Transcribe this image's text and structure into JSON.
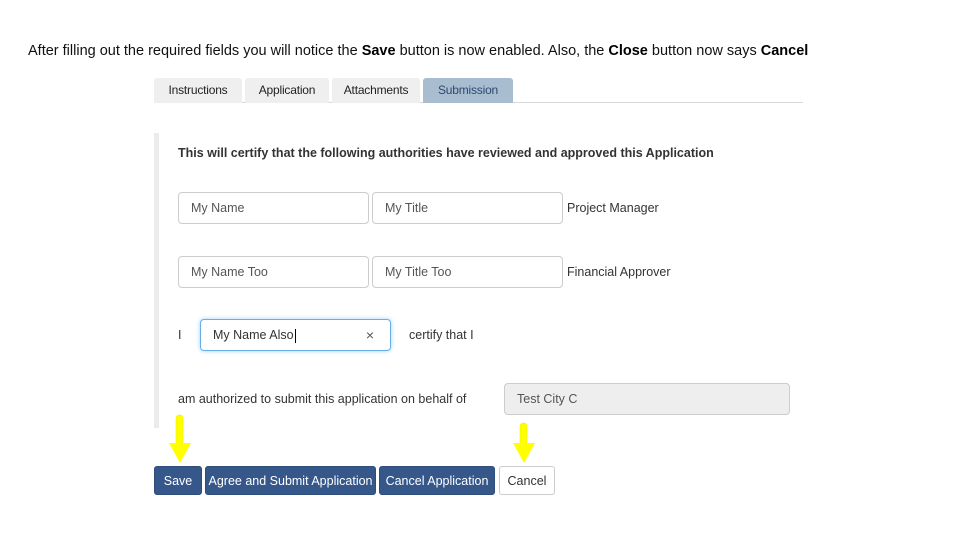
{
  "caption": {
    "part1": "After filling out the required fields you will notice the ",
    "bold1": "Save",
    "part2": " button is now enabled. Also, the ",
    "bold2": "Close",
    "part3": " button now says ",
    "bold3": "Cancel"
  },
  "tabs": [
    {
      "label": "Instructions",
      "active": false
    },
    {
      "label": "Application",
      "active": false
    },
    {
      "label": "Attachments",
      "active": false
    },
    {
      "label": "Submission",
      "active": true
    }
  ],
  "form": {
    "heading": "This will certify that the following authorities have reviewed and approved this Application",
    "approvers": [
      {
        "name": "My Name",
        "title": "My Title",
        "role": "Project Manager"
      },
      {
        "name": "My Name Too",
        "title": "My Title Too",
        "role": "Financial Approver"
      }
    ],
    "certify_prefix": "I",
    "certify_name": "My Name Also",
    "certify_suffix": "certify that I",
    "authorized_text": "am authorized to submit this application on behalf of",
    "organization": "Test City C",
    "clear_icon": "×"
  },
  "buttons": {
    "save": "Save",
    "agree_submit": "Agree and Submit Application",
    "cancel_application": "Cancel Application",
    "cancel": "Cancel"
  },
  "annotations": {
    "arrow_color": "#ffff00"
  }
}
